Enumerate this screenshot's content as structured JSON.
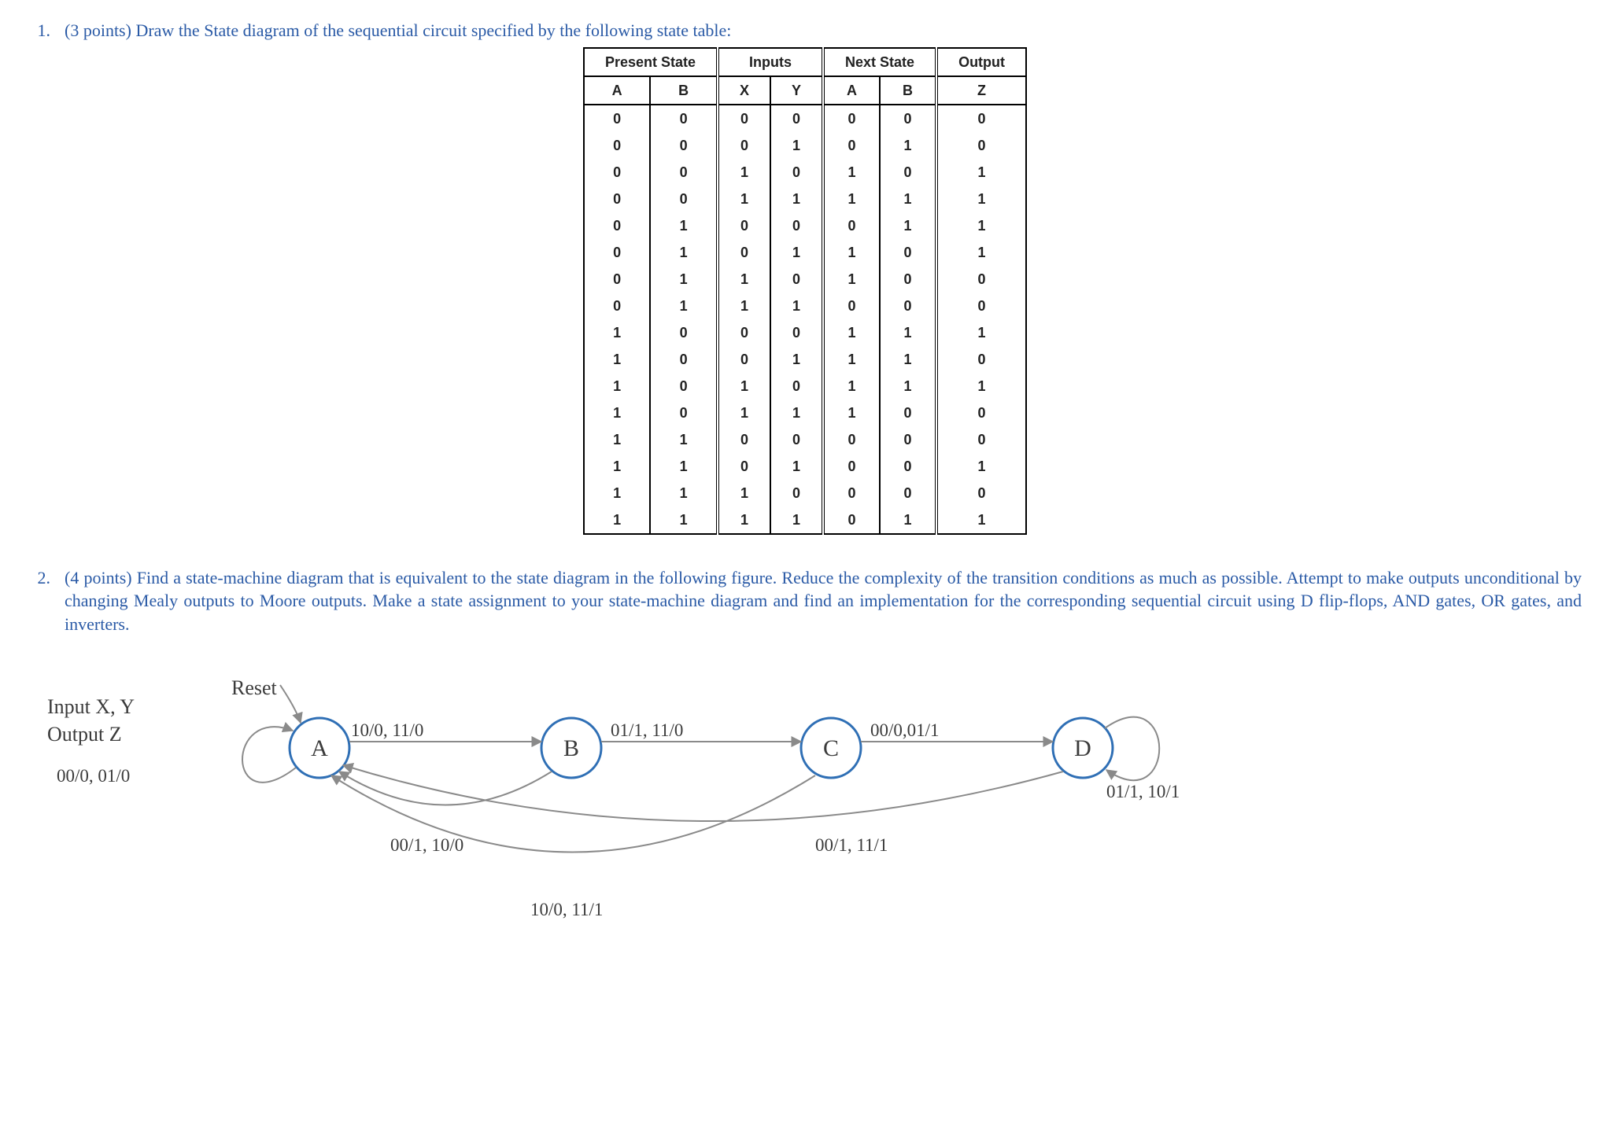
{
  "q1": {
    "number": "1.",
    "points": "(3 points)",
    "prompt": "Draw the State diagram of the sequential circuit specified by the following state table:",
    "header_groups": [
      "Present State",
      "Inputs",
      "Next State",
      "Output"
    ],
    "sub_headers": [
      "A",
      "B",
      "X",
      "Y",
      "A",
      "B",
      "Z"
    ],
    "rows": [
      [
        "0",
        "0",
        "0",
        "0",
        "0",
        "0",
        "0"
      ],
      [
        "0",
        "0",
        "0",
        "1",
        "0",
        "1",
        "0"
      ],
      [
        "0",
        "0",
        "1",
        "0",
        "1",
        "0",
        "1"
      ],
      [
        "0",
        "0",
        "1",
        "1",
        "1",
        "1",
        "1"
      ],
      [
        "0",
        "1",
        "0",
        "0",
        "0",
        "1",
        "1"
      ],
      [
        "0",
        "1",
        "0",
        "1",
        "1",
        "0",
        "1"
      ],
      [
        "0",
        "1",
        "1",
        "0",
        "1",
        "0",
        "0"
      ],
      [
        "0",
        "1",
        "1",
        "1",
        "0",
        "0",
        "0"
      ],
      [
        "1",
        "0",
        "0",
        "0",
        "1",
        "1",
        "1"
      ],
      [
        "1",
        "0",
        "0",
        "1",
        "1",
        "1",
        "0"
      ],
      [
        "1",
        "0",
        "1",
        "0",
        "1",
        "1",
        "1"
      ],
      [
        "1",
        "0",
        "1",
        "1",
        "1",
        "0",
        "0"
      ],
      [
        "1",
        "1",
        "0",
        "0",
        "0",
        "0",
        "0"
      ],
      [
        "1",
        "1",
        "0",
        "1",
        "0",
        "0",
        "1"
      ],
      [
        "1",
        "1",
        "1",
        "0",
        "0",
        "0",
        "0"
      ],
      [
        "1",
        "1",
        "1",
        "1",
        "0",
        "1",
        "1"
      ]
    ]
  },
  "q2": {
    "number": "2.",
    "points": "(4 points)",
    "prompt": "Find a state-machine diagram that is equivalent to the state diagram in the following figure. Reduce the complexity of the transition conditions as much as possible. Attempt to make outputs unconditional by changing Mealy outputs to Moore outputs. Make a state assignment to your state-machine diagram and find an implementation for the corresponding sequential circuit using D flip-flops, AND gates, OR gates, and inverters."
  },
  "diagram": {
    "inputs_label_line1": "Input X, Y",
    "inputs_label_line2": "Output Z",
    "reset_label": "Reset",
    "states": {
      "A": "A",
      "B": "B",
      "C": "C",
      "D": "D"
    },
    "edge_AA": "00/0, 01/0",
    "edge_AB": "10/0, 11/0",
    "edge_BA": "00/1, 10/0",
    "edge_BC": "01/1, 11/0",
    "edge_CA": "10/0, 11/1",
    "edge_CD": "00/0,01/1",
    "edge_DA": "00/1, 11/1",
    "edge_DD": "01/1, 10/1"
  }
}
